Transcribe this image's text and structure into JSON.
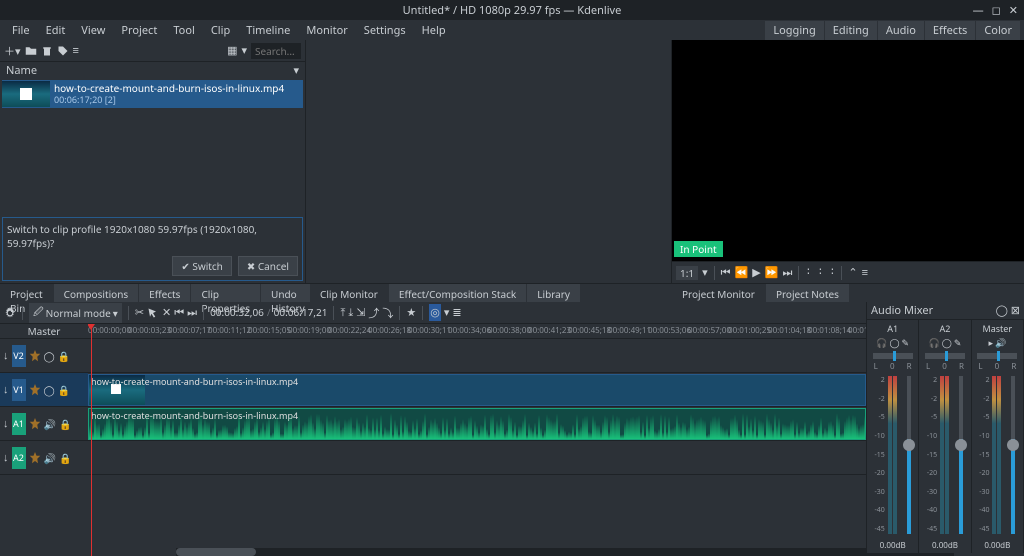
{
  "title": "Untitled* / HD 1080p 29.97 fps — Kdenlive",
  "menu": [
    "File",
    "Edit",
    "View",
    "Project",
    "Tool",
    "Clip",
    "Timeline",
    "Monitor",
    "Settings",
    "Help"
  ],
  "right_menu": [
    "Logging",
    "Editing",
    "Audio",
    "Effects",
    "Color"
  ],
  "bin": {
    "search_placeholder": "Search...",
    "header": "Name",
    "item": {
      "name": "how-to-create-mount-and-burn-isos-in-linux.mp4",
      "duration": "00:06:17;20 [2]"
    },
    "prompt": "Switch to clip profile 1920x1080 59.97fps (1920x1080, 59.97fps)?",
    "switch": "Switch",
    "cancel": "Cancel"
  },
  "left_tabs": [
    "Project Bin",
    "Compositions",
    "Effects",
    "Clip Properties",
    "Undo History"
  ],
  "center_tabs": [
    "Clip Monitor",
    "Effect/Composition Stack",
    "Library"
  ],
  "right_tabs": [
    "Project Monitor",
    "Project Notes"
  ],
  "monitor": {
    "in_point": "In Point",
    "scale": "1:1",
    "time": ":  :  :"
  },
  "timeline": {
    "mode": "Normal mode",
    "time_current": "00:00:32,06",
    "time_total": "00:06:17,21",
    "master": "Master",
    "tracks": [
      "V2",
      "V1",
      "A1",
      "A2"
    ],
    "clip_video": "how-to-create-mount-and-burn-isos-in-linux.mp4",
    "clip_audio": "how-to-create-mount-and-burn-isos-in-linux.mp4",
    "ruler": [
      "00:00:00;00",
      "00:00:03;23",
      "00:00:07;17",
      "00:00:11;12",
      "00:00:15;05",
      "00:00:19;00",
      "00:00:22;24",
      "00:00:26;18",
      "00:00:30;11",
      "00:00:34;06",
      "00:00:38;00",
      "00:00:41;23",
      "00:00:45;18",
      "00:00:49;11",
      "00:00:53;06",
      "00:00:57;00",
      "00:01:00;25",
      "00:01:04;18",
      "00:01:08;14",
      "00:01:12;07",
      "00:01:16"
    ]
  },
  "mixer": {
    "title": "Audio Mixer",
    "channels": [
      "A1",
      "A2",
      "Master"
    ],
    "db": "0.00dB",
    "scale": [
      "2",
      "-2",
      "-5",
      "-10",
      "-15",
      "-20",
      "-30",
      "-40",
      "-45"
    ]
  }
}
